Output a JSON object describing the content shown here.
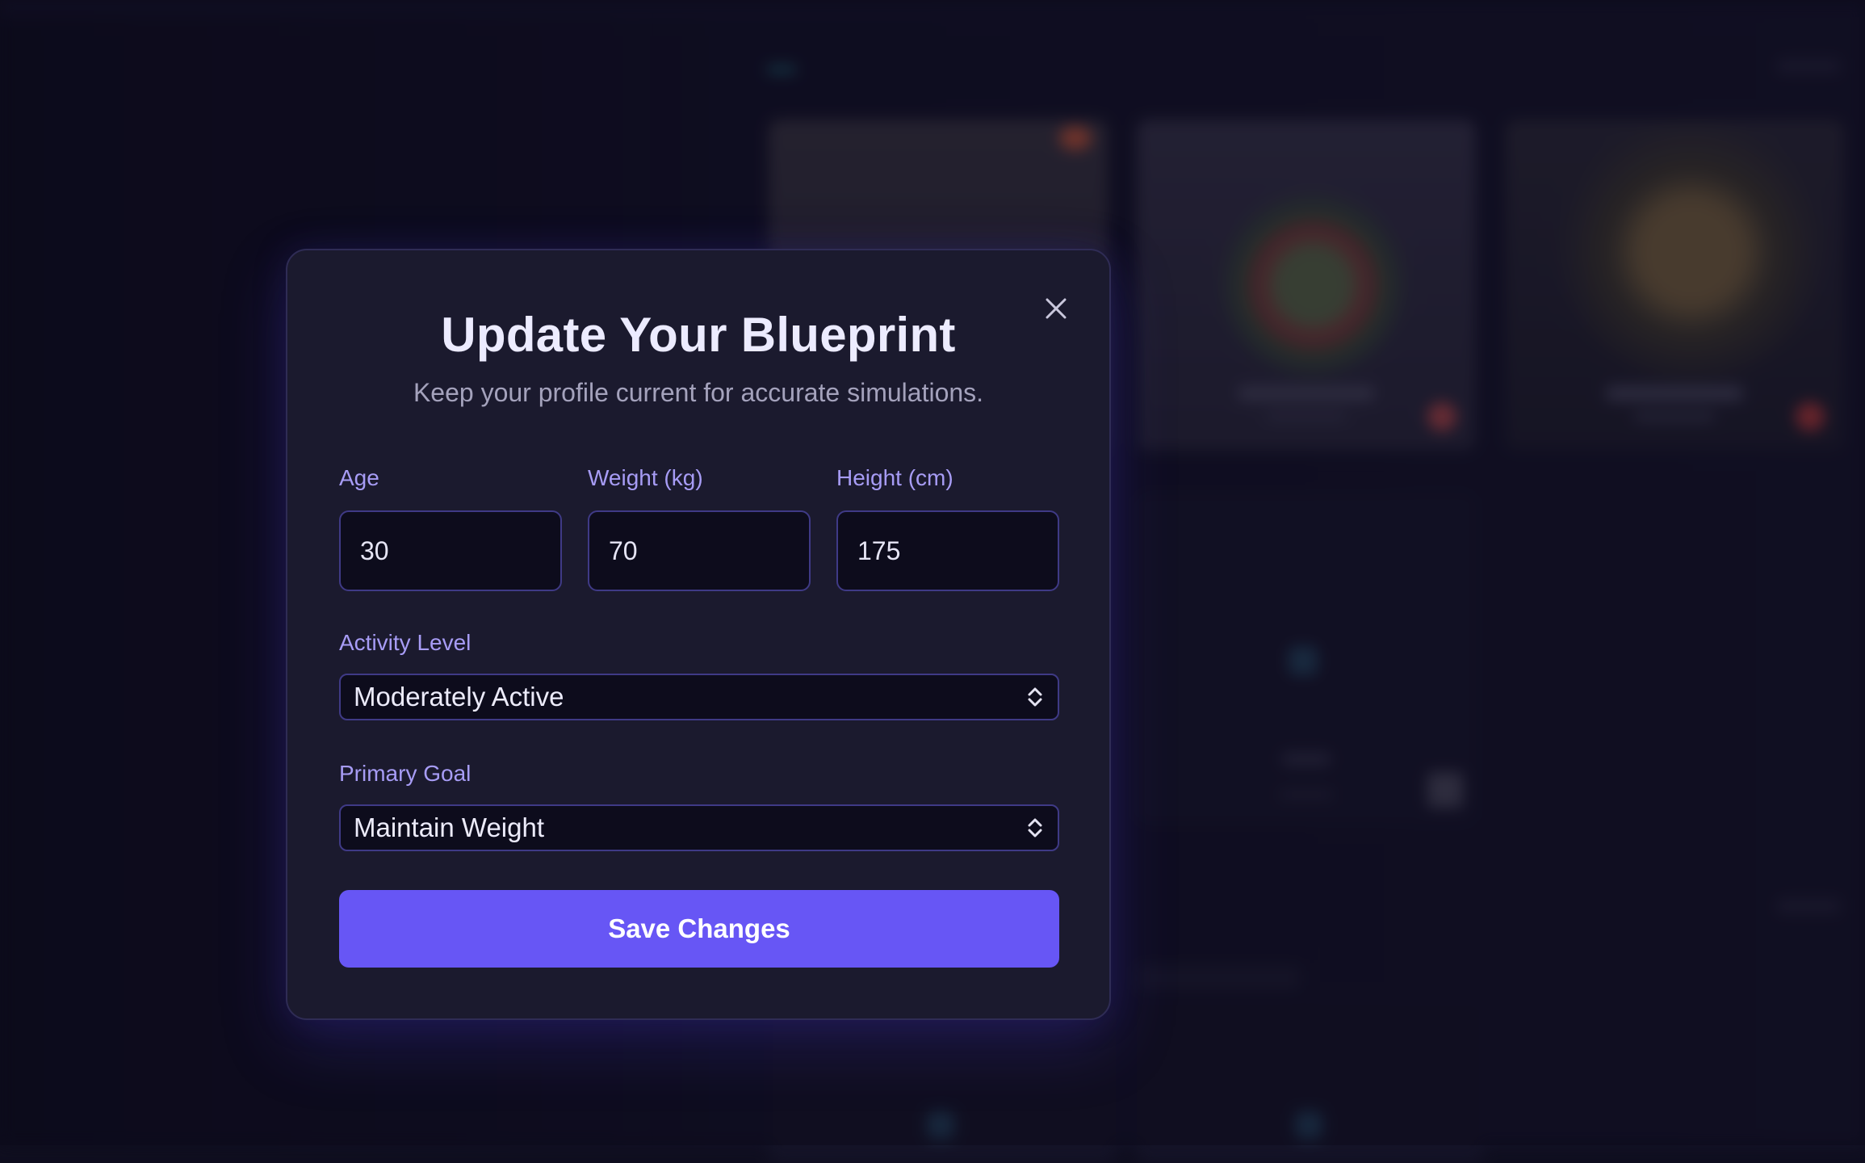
{
  "modal": {
    "title": "Update Your Blueprint",
    "subtitle": "Keep your profile current for accurate simulations.",
    "close_icon": "close-icon",
    "fields": {
      "age": {
        "label": "Age",
        "value": "30"
      },
      "weight": {
        "label": "Weight (kg)",
        "value": "70"
      },
      "height": {
        "label": "Height (cm)",
        "value": "175"
      }
    },
    "activity": {
      "label": "Activity Level",
      "selected": "Moderately Active",
      "icon": "chevron-up-down-icon"
    },
    "goal": {
      "label": "Primary Goal",
      "selected": "Maintain Weight",
      "icon": "chevron-up-down-icon"
    },
    "save_label": "Save Changes"
  },
  "colors": {
    "accent": "#6756f5",
    "label": "#a79cf5",
    "modal_bg": "#1b1a2e",
    "input_border": "#3f3a86"
  }
}
